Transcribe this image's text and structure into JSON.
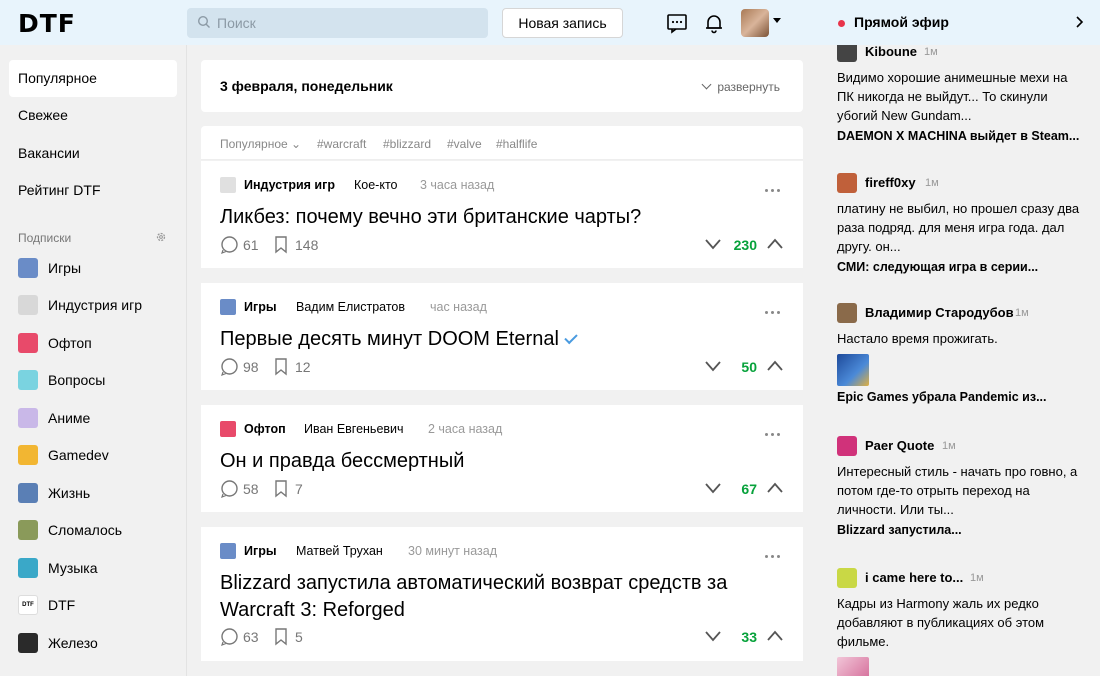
{
  "header": {
    "logo": "DTF",
    "search_placeholder": "Поиск",
    "new_post_label": "Новая запись"
  },
  "sidebar": {
    "nav": [
      "Популярное",
      "Свежее",
      "Вакансии",
      "Рейтинг DTF"
    ],
    "subs_label": "Подписки",
    "subs": [
      {
        "label": "Игры",
        "icon": "games-icon",
        "color": "#6a8cc7"
      },
      {
        "label": "Индустрия игр",
        "icon": "industry-icon",
        "color": "#b7b7b7"
      },
      {
        "label": "Офтоп",
        "icon": "offtop-icon",
        "color": "#e84a6a"
      },
      {
        "label": "Вопросы",
        "icon": "questions-icon",
        "color": "#7ad3e0"
      },
      {
        "label": "Аниме",
        "icon": "anime-icon",
        "color": "#c9b8e8"
      },
      {
        "label": "Gamedev",
        "icon": "gamedev-icon",
        "color": "#f2b632"
      },
      {
        "label": "Жизнь",
        "icon": "life-icon",
        "color": "#5a7fb5"
      },
      {
        "label": "Сломалось",
        "icon": "broken-icon",
        "color": "#8a9a5a"
      },
      {
        "label": "Музыка",
        "icon": "music-icon",
        "color": "#3aa8c8"
      },
      {
        "label": "DTF",
        "icon": "dtf-icon",
        "color": "#ffffff"
      },
      {
        "label": "Железо",
        "icon": "hardware-icon",
        "color": "#2a2a2a"
      }
    ]
  },
  "feed": {
    "date_title": "3 февраля, понедельник",
    "expand_label": "развернуть",
    "filters": [
      "Популярное",
      "#warcraft",
      "#blizzard",
      "#valve",
      "#halflife"
    ],
    "posts": [
      {
        "category": "Индустрия игр",
        "author": "Кое-кто",
        "time": "3 часа назад",
        "title": "Ликбез: почему вечно эти британские чарты?",
        "comments": "61",
        "bookmarks": "148",
        "rating": "230",
        "cat_color": "#9a9a9a"
      },
      {
        "category": "Игры",
        "author": "Вадим Елистратов",
        "time": "час назад",
        "title": "Первые десять минут DOOM Eternal",
        "comments": "98",
        "bookmarks": "12",
        "rating": "50",
        "cat_color": "#6a8cc7"
      },
      {
        "category": "Офтоп",
        "author": "Иван Евгеньевич",
        "time": "2 часа назад",
        "title": "Он и правда бессмертный",
        "comments": "58",
        "bookmarks": "7",
        "rating": "67",
        "cat_color": "#e84a6a"
      },
      {
        "category": "Игры",
        "author": "Матвей Трухан",
        "time": "30 минут назад",
        "title": "Blizzard запустила автоматический возврат средств за Warcraft 3: Reforged",
        "comments": "63",
        "bookmarks": "5",
        "rating": "33",
        "cat_color": "#6a8cc7"
      }
    ]
  },
  "live": {
    "title": "Прямой эфир",
    "items": [
      {
        "user": "Kiboune",
        "time": "1м",
        "text": "Видимо хорошие анимешные мехи на ПК никогда не выйдут... То скинули убогий New Gundam...",
        "post": "DAEMON X MACHINA выйдет в Steam...",
        "color": "#444444"
      },
      {
        "user": "fireff0xy",
        "time": "1м",
        "text": "платину не выбил, но прошел сразу два раза подряд. для меня игра года. дал другу. он...",
        "post": "СМИ: следующая игра в серии...",
        "color": "#c0603a"
      },
      {
        "user": "Владимир Стародубов",
        "time": "1м",
        "text": "Настало время прожигать.",
        "post": "Epic Games убрала Pandemic из...",
        "color": "#8a6a4a"
      },
      {
        "user": "Paer Quote",
        "time": "1м",
        "text": "Интересный стиль - начать про говно, а потом где-то отрыть переход на личности. Или ты...",
        "post": "Blizzard запустила...",
        "color": "#d0327a"
      },
      {
        "user": "i came here to...",
        "time": "1м",
        "text": "Кадры из Harmony жаль их редко добавляют в публикациях об этом фильме.",
        "post": "",
        "color": "#c9d845"
      }
    ]
  },
  "colors": {
    "accent_green": "#07a23b",
    "header_bg": "#e8f4fc",
    "live_dot": "#e8344a"
  }
}
